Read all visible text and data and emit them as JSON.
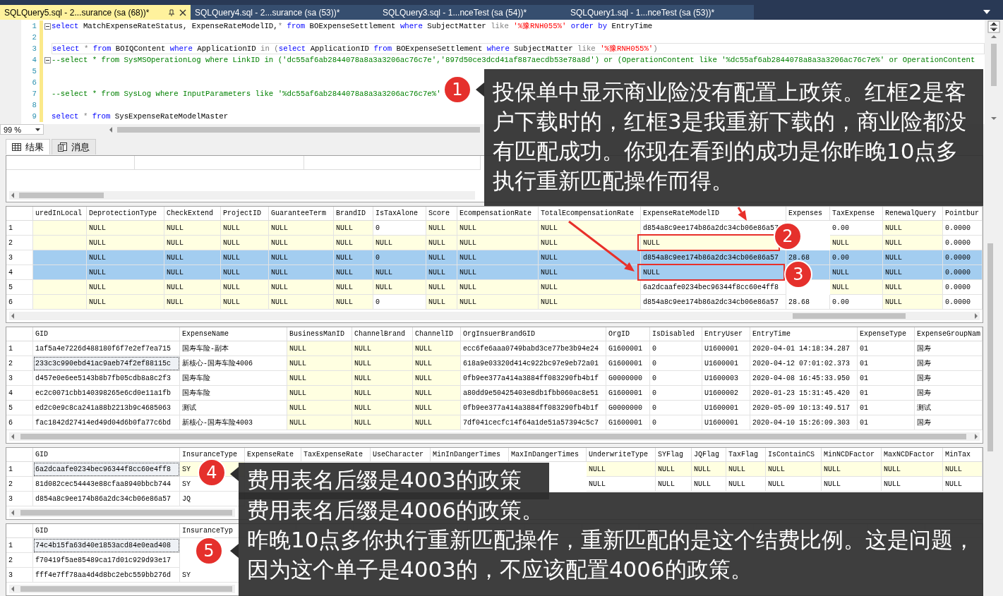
{
  "tabs": [
    {
      "label": "SQLQuery5.sql - 2...surance (sa (68))*",
      "selected": true
    },
    {
      "label": "SQLQuery4.sql - 2...surance (sa (53))*",
      "selected": false
    },
    {
      "label": "SQLQuery3.sql - 1...nceTest (sa (54))*",
      "selected": false
    },
    {
      "label": "SQLQuery1.sql - 1...nceTest (sa (53))*",
      "selected": false
    }
  ],
  "editor": {
    "lines": [
      {
        "n": "1",
        "fold": true,
        "current": false,
        "tokens": [
          {
            "kind": "kw",
            "text": "select"
          },
          {
            "kind": "id",
            "text": " MatchExpenseRateStatus, ExpenseRateModelID,"
          },
          {
            "kind": "op",
            "text": "*"
          },
          {
            "kind": "kw",
            "text": " from"
          },
          {
            "kind": "id",
            "text": " BOExpenseSettlement "
          },
          {
            "kind": "kw",
            "text": "where"
          },
          {
            "kind": "id",
            "text": " SubjectMatter "
          },
          {
            "kind": "op",
            "text": "like"
          },
          {
            "kind": "str",
            "text": " '%豫RNH055%'"
          },
          {
            "kind": "kw",
            "text": " order by"
          },
          {
            "kind": "id",
            "text": " EntryTime"
          }
        ]
      },
      {
        "n": "2",
        "fold": false,
        "current": false
      },
      {
        "n": "3",
        "fold": false,
        "current": true,
        "tokens": [
          {
            "kind": "kw",
            "text": "select"
          },
          {
            "kind": "op",
            "text": " *"
          },
          {
            "kind": "kw",
            "text": " from"
          },
          {
            "kind": "id",
            "text": " BOIQContent "
          },
          {
            "kind": "kw",
            "text": "where"
          },
          {
            "kind": "id",
            "text": " ApplicationID "
          },
          {
            "kind": "op",
            "text": "in"
          },
          {
            "kind": "op",
            "text": " ("
          },
          {
            "kind": "kw",
            "text": "select"
          },
          {
            "kind": "id",
            "text": " ApplicationID "
          },
          {
            "kind": "kw",
            "text": "from"
          },
          {
            "kind": "id",
            "text": " BOExpenseSettlement "
          },
          {
            "kind": "kw",
            "text": "where"
          },
          {
            "kind": "id",
            "text": " SubjectMatter "
          },
          {
            "kind": "op",
            "text": "like"
          },
          {
            "kind": "str",
            "text": " '%豫RNH055%'"
          },
          {
            "kind": "op",
            "text": ")"
          }
        ]
      },
      {
        "n": "4",
        "fold": true,
        "current": false,
        "tokens": [
          {
            "kind": "cmt",
            "text": "--select * from SysMSOperationLog where LinkID in ('dc55af6ab2844078a8a3a3206ac76c7e','897d50ce3dcd41af887aecdb53e78a8d') or (OperationContent like '%dc55af6ab2844078a8a3a3206ac76c7e%' or OperationContent"
          }
        ]
      },
      {
        "n": "5",
        "fold": false,
        "current": false
      },
      {
        "n": "6",
        "fold": false,
        "current": false
      },
      {
        "n": "7",
        "fold": false,
        "current": false,
        "tokens": [
          {
            "kind": "cmt",
            "text": "--select * from SysLog where InputParameters like '%dc55af6ab2844078a8a3a3206ac76c7e%'"
          }
        ]
      },
      {
        "n": "8",
        "fold": false,
        "current": false
      },
      {
        "n": "9",
        "fold": false,
        "current": false,
        "tokens": [
          {
            "kind": "kw",
            "text": "select"
          },
          {
            "kind": "op",
            "text": " *"
          },
          {
            "kind": "kw",
            "text": " from"
          },
          {
            "kind": "id",
            "text": " SysExpenseRateModelMaster"
          }
        ]
      }
    ]
  },
  "zoom": {
    "value": "99 %"
  },
  "result_tabs": [
    {
      "label": "结果",
      "kind": "grid",
      "selected": true
    },
    {
      "label": "消息",
      "kind": "messages",
      "selected": false
    }
  ],
  "grids": [
    {
      "columns": [
        "uredInLocal",
        "DeprotectionType",
        "CheckExtend",
        "ProjectID",
        "GuaranteeTerm",
        "BrandID",
        "IsTaxAlone",
        "Score",
        "EcompensationRate",
        "TotalEcompensationRate",
        "ExpenseRateModelID",
        "Expenses",
        "TaxExpense",
        "RenewalQuery",
        "Pointbur"
      ],
      "rows": [
        {
          "n": "1",
          "selected": false,
          "focused": false,
          "cells": [
            null,
            "NULL",
            "NULL",
            "NULL",
            "NULL",
            "NULL",
            "0",
            "NULL",
            "NULL",
            "NULL",
            "d854a8c9ee174b86a2dc34cb06e86a57",
            null,
            "0.00",
            "NULL",
            "0.0000"
          ],
          "shaded": [
            true,
            true,
            true,
            true,
            true,
            true,
            false,
            true,
            true,
            true,
            false,
            false,
            false,
            true,
            false
          ]
        },
        {
          "n": "2",
          "selected": false,
          "focused": false,
          "cells": [
            null,
            "NULL",
            "NULL",
            "NULL",
            "NULL",
            "NULL",
            "NULL",
            "NULL",
            "NULL",
            "NULL",
            "NULL",
            null,
            "NULL",
            "NULL",
            "0.0000"
          ],
          "shaded": [
            true,
            true,
            true,
            true,
            true,
            true,
            true,
            true,
            true,
            true,
            true,
            false,
            true,
            true,
            false
          ]
        },
        {
          "n": "3",
          "selected": true,
          "focused": false,
          "cells": [
            null,
            "NULL",
            "NULL",
            "NULL",
            "NULL",
            "NULL",
            "0",
            "NULL",
            "NULL",
            "NULL",
            "d854a8c9ee174b86a2dc34cb06e86a57",
            "28.68",
            "0.00",
            "NULL",
            "0.0000"
          ]
        },
        {
          "n": "4",
          "selected": true,
          "focused": false,
          "cells": [
            null,
            "NULL",
            "NULL",
            "NULL",
            "NULL",
            "NULL",
            "NULL",
            "NULL",
            "NULL",
            "NULL",
            "NULL",
            null,
            "NULL",
            "NULL",
            "0.0000"
          ]
        },
        {
          "n": "5",
          "selected": false,
          "focused": false,
          "cells": [
            null,
            "NULL",
            "NULL",
            "NULL",
            "NULL",
            "NULL",
            "NULL",
            "NULL",
            "NULL",
            "NULL",
            "6a2dcaafe0234bec96344f8cc60e4ff8",
            null,
            "NULL",
            "NULL",
            "0.0000"
          ],
          "shaded": [
            true,
            true,
            true,
            true,
            true,
            true,
            true,
            true,
            true,
            true,
            false,
            false,
            true,
            true,
            false
          ]
        },
        {
          "n": "6",
          "selected": false,
          "focused": false,
          "cells": [
            null,
            "NULL",
            "NULL",
            "NULL",
            "NULL",
            "NULL",
            "0",
            "NULL",
            "NULL",
            "NULL",
            "d854a8c9ee174b86a2dc34cb06e86a57",
            "28.68",
            "0.00",
            "NULL",
            "0.0000"
          ],
          "shaded": [
            true,
            true,
            true,
            true,
            true,
            true,
            false,
            true,
            true,
            true,
            false,
            false,
            false,
            true,
            false
          ]
        }
      ]
    },
    {
      "columns": [
        "GID",
        "ExpenseName",
        "BusinessManID",
        "ChannelBrand",
        "ChannelID",
        "OrgInsuerBrandGID",
        "OrgID",
        "IsDisabled",
        "EntryUser",
        "EntryTime",
        "ExpenseType",
        "ExpenseGroupNam"
      ],
      "rows": [
        {
          "n": "1",
          "selected": false,
          "focused": false,
          "cells": [
            "1af5a4e7226d488180f6f7e2ef7ea715",
            "国寿车险-副本",
            "NULL",
            "NULL",
            "NULL",
            "ecc6fe6aaa0749babd3ce77be3b94e24",
            "G1600001",
            "0",
            "U1600001",
            "2020-04-01 14:18:34.287",
            "01",
            "国寿"
          ],
          "shaded": [
            false,
            false,
            true,
            true,
            true,
            false,
            false,
            false,
            false,
            false,
            false,
            false
          ]
        },
        {
          "n": "2",
          "selected": false,
          "focused": true,
          "cells": [
            "233c3c990ebd41ac9aeb74f2ef88115c",
            "新核心-国寿车险4006",
            "NULL",
            "NULL",
            "NULL",
            "618a9e03320d414c922bc97e9eb72a01",
            "G1600001",
            "0",
            "U1600001",
            "2020-04-12 07:01:02.373",
            "01",
            "国寿"
          ],
          "shaded": [
            false,
            false,
            true,
            true,
            true,
            false,
            false,
            false,
            false,
            false,
            false,
            false
          ]
        },
        {
          "n": "3",
          "selected": false,
          "focused": false,
          "cells": [
            "d457e0e6ee5143b8b7fb05cdb8a8c2f3",
            "国寿车险",
            "NULL",
            "NULL",
            "NULL",
            "0fb9ee377a414a3884ff083290fb4b1f",
            "G0000000",
            "0",
            "U1600003",
            "2020-04-08 16:45:33.950",
            "01",
            "国寿"
          ],
          "shaded": [
            false,
            false,
            true,
            true,
            true,
            false,
            false,
            false,
            false,
            false,
            false,
            false
          ]
        },
        {
          "n": "4",
          "selected": false,
          "focused": false,
          "cells": [
            "ec2c0071cbb140398265e6cd0e11a1fb",
            "国寿车险",
            "NULL",
            "NULL",
            "NULL",
            "a80dd9e50425403e8db1fbb060ac8e51",
            "G1600001",
            "0",
            "U1600002",
            "2020-01-23 15:31:45.420",
            "01",
            "国寿"
          ],
          "shaded": [
            false,
            false,
            true,
            true,
            true,
            false,
            false,
            false,
            false,
            false,
            false,
            false
          ]
        },
        {
          "n": "5",
          "selected": false,
          "focused": false,
          "cells": [
            "ed2c0e9c8ca241a88b2213b9c4685063",
            "测试",
            "NULL",
            "NULL",
            "NULL",
            "0fb9ee377a414a3884ff083290fb4b1f",
            "G0000000",
            "0",
            "U1600001",
            "2020-05-09 10:13:49.517",
            "01",
            "测试"
          ],
          "shaded": [
            false,
            false,
            true,
            true,
            true,
            false,
            false,
            false,
            false,
            false,
            false,
            false
          ]
        },
        {
          "n": "6",
          "selected": false,
          "focused": false,
          "cells": [
            "fac1842d27414ed49d04d6b0fa77c6bd",
            "新核心-国寿车险4003",
            "NULL",
            "NULL",
            "NULL",
            "7df041cecfc14f64a1de51a57394c5c7",
            "G1600001",
            "0",
            "U1600001",
            "2020-04-10 15:26:09.303",
            "01",
            "国寿"
          ],
          "shaded": [
            false,
            false,
            true,
            true,
            true,
            false,
            false,
            false,
            false,
            false,
            false,
            false
          ]
        }
      ]
    },
    {
      "columns": [
        "GID",
        "InsuranceType",
        "ExpenseRate",
        "TaxExpenseRate",
        "UseCharacter",
        "MinInDangerTimes",
        "MaxInDangerTimes",
        "UnderwriteType",
        "SYFlag",
        "JQFlag",
        "TaxFlag",
        "IsContainCS",
        "MinNCDFactor",
        "MaxNCDFactor",
        "MinTax"
      ],
      "rows": [
        {
          "n": "1",
          "selected": false,
          "focused": true,
          "cells": [
            "6a2dcaafe0234bec96344f8cc60e4ff8",
            "SY",
            null,
            null,
            null,
            null,
            null,
            "NULL",
            "NULL",
            "NULL",
            "NULL",
            "NULL",
            "NULL",
            "NULL",
            "NULL"
          ],
          "shaded": [
            false,
            true,
            false,
            false,
            false,
            false,
            false,
            true,
            true,
            true,
            true,
            true,
            true,
            true,
            true
          ]
        },
        {
          "n": "2",
          "selected": false,
          "focused": false,
          "cells": [
            "81d082cec54443e88cfaa8940bbcb744",
            "SY",
            null,
            null,
            null,
            null,
            null,
            "NULL",
            "NULL",
            "NULL",
            "NULL",
            "NULL",
            "NULL",
            "NULL",
            "NULL"
          ]
        },
        {
          "n": "3",
          "selected": false,
          "focused": false,
          "cells": [
            "d854a8c9ee174b86a2dc34cb06e86a57",
            "JQ",
            null,
            null,
            null,
            null,
            null,
            null,
            null,
            null,
            null,
            null,
            null,
            null,
            null
          ]
        }
      ]
    },
    {
      "columns": [
        "GID",
        "InsuranceTyp",
        null,
        null,
        null,
        null,
        null,
        null,
        null,
        null,
        null,
        null,
        null,
        null,
        null
      ],
      "rows": [
        {
          "n": "1",
          "selected": false,
          "focused": true,
          "cells": [
            "74c4b15fa63d40e1853acd84e0ead408",
            null,
            null,
            null,
            null,
            null,
            null,
            null,
            null,
            null,
            null,
            null,
            null,
            null,
            null
          ]
        },
        {
          "n": "2",
          "selected": false,
          "focused": false,
          "cells": [
            "f70419f5ae85489ca17d01c929d93e17",
            null,
            null,
            null,
            null,
            null,
            null,
            null,
            null,
            null,
            null,
            null,
            null,
            null,
            null
          ]
        },
        {
          "n": "3",
          "selected": false,
          "focused": false,
          "cells": [
            "fff4e7ff78aa4d4d8bc2ebc559bb276d",
            "SY",
            null,
            null,
            null,
            null,
            null,
            null,
            null,
            null,
            null,
            null,
            null,
            null,
            null
          ]
        }
      ]
    }
  ],
  "annotations": [
    {
      "kind": "callout",
      "number": "1",
      "paragraphs": [
        "投保单中显示商业险没有配置上政策。红框2是客户下载时的，红框3是我重新下载的，商业险都没有匹配成功。你现在看到的成功是你昨晚10点多执行重新匹配操作而得。"
      ]
    },
    {
      "kind": "marker",
      "number": "2"
    },
    {
      "kind": "marker",
      "number": "3"
    },
    {
      "kind": "callout",
      "number": "4",
      "paragraphs": [
        "费用表名后缀是4003的政策"
      ]
    },
    {
      "kind": "callout",
      "number": "5",
      "paragraphs": [
        "费用表名后缀是4006的政策。",
        "昨晚10点多你执行重新匹配操作，重新匹配的是这个结费比例。这是问题，因为这个单子是4003的，不应该配置4006的政策。"
      ]
    }
  ]
}
